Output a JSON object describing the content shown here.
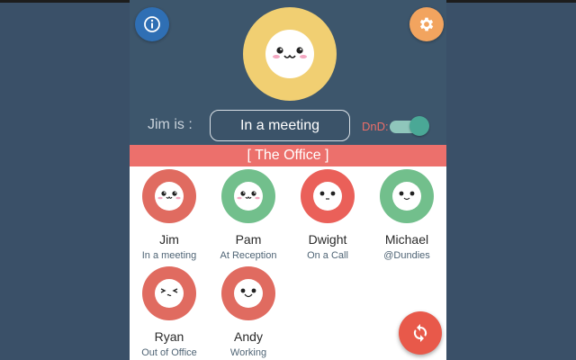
{
  "colors": {
    "red": "#e06b60",
    "green": "#72bf8c",
    "yellow": "#f1cf72",
    "group_bar": "#ec706c"
  },
  "header": {
    "user_label": "Jim is :",
    "status_value": "In a meeting",
    "dnd_label": "DnD:",
    "dnd_on": true,
    "info_icon": "info-icon",
    "settings_icon": "gear-icon"
  },
  "group": {
    "name": "[ The Office ]"
  },
  "people": [
    {
      "name": "Jim",
      "status": "In a meeting",
      "color": "#e06b60",
      "face": "blush"
    },
    {
      "name": "Pam",
      "status": "At Reception",
      "color": "#72bf8c",
      "face": "blush"
    },
    {
      "name": "Dwight",
      "status": "On a Call",
      "color": "#ea6059",
      "face": "plain"
    },
    {
      "name": "Michael",
      "status": "@Dundies",
      "color": "#72bf8c",
      "face": "happy"
    },
    {
      "name": "Ryan",
      "status": "Out of Office",
      "color": "#e06b60",
      "face": "squint"
    },
    {
      "name": "Andy",
      "status": "Working",
      "color": "#e06b60",
      "face": "smile"
    }
  ],
  "refresh_icon": "refresh-icon"
}
